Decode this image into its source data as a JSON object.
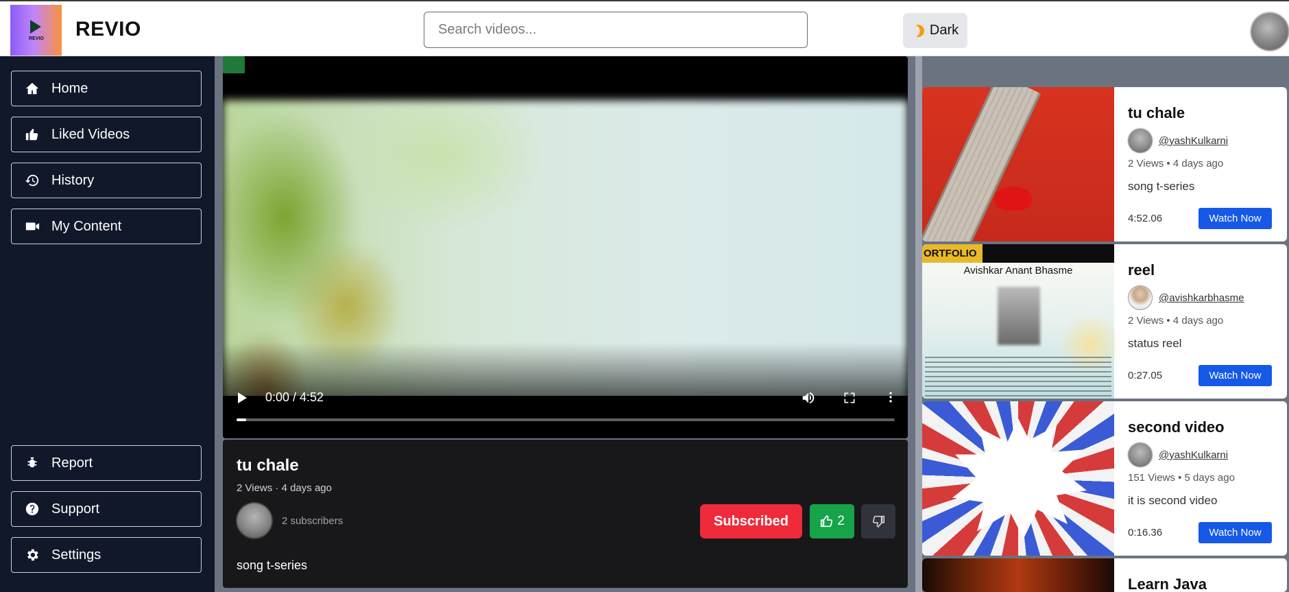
{
  "header": {
    "logo_text": "REVIO",
    "brand": "REVIO",
    "search_placeholder": "Search videos...",
    "theme_label": "Dark"
  },
  "sidebar": {
    "top_items": [
      {
        "label": "Home",
        "icon": "home-icon"
      },
      {
        "label": "Liked Videos",
        "icon": "thumbs-up-icon"
      },
      {
        "label": "History",
        "icon": "history-icon"
      },
      {
        "label": "My Content",
        "icon": "video-camera-icon"
      }
    ],
    "bottom_items": [
      {
        "label": "Report",
        "icon": "bug-icon"
      },
      {
        "label": "Support",
        "icon": "question-icon"
      },
      {
        "label": "Settings",
        "icon": "gear-icon"
      }
    ]
  },
  "player": {
    "time": "0:00 / 4:52",
    "progress": 0.015
  },
  "video_info": {
    "title": "tu chale",
    "meta": "2 Views · 4 days ago",
    "subscribers": "2 subscribers",
    "subscribe_label": "Subscribed",
    "likes": "2",
    "description": "song t-series"
  },
  "related": [
    {
      "title": "tu chale",
      "handle": "@yashKulkarni",
      "meta": "2 Views • 4 days ago",
      "description": "song t-series",
      "duration": "4:52.06",
      "watch_label": "Watch Now"
    },
    {
      "title": "reel",
      "handle": "@avishkarbhasme",
      "meta": "2 Views • 4 days ago",
      "description": "status reel",
      "duration": "0:27.05",
      "watch_label": "Watch Now",
      "thumb_tag": "ORTFOLIO",
      "thumb_name": "Avishkar Anant Bhasme"
    },
    {
      "title": "second video",
      "handle": "@yashKulkarni",
      "meta": "151 Views • 5 days ago",
      "description": "it is second video",
      "duration": "0:16.36",
      "watch_label": "Watch Now"
    },
    {
      "title": "Learn Java"
    }
  ],
  "colors": {
    "sidebar_bg": "#10182a",
    "subscribe_red": "#ef2b3b",
    "like_green": "#16a34a",
    "watch_blue": "#1559e6"
  }
}
